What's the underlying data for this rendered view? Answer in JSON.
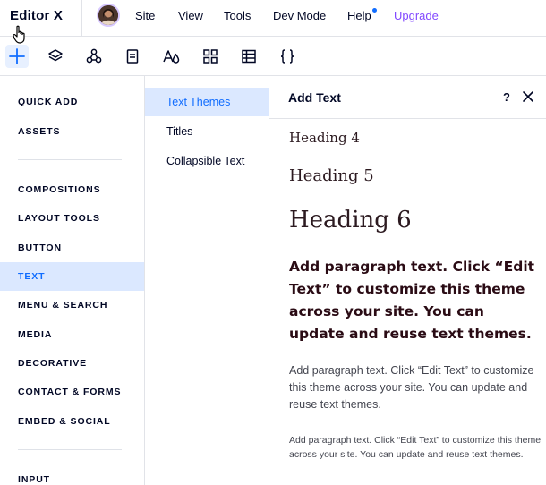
{
  "topbar": {
    "logo": "Editor X",
    "menu": [
      "Site",
      "View",
      "Tools",
      "Dev Mode",
      "Help",
      "Upgrade"
    ]
  },
  "toolbar": {
    "tools": [
      "add-icon",
      "layers-icon",
      "components-icon",
      "pages-icon",
      "text-styles-icon",
      "apps-icon",
      "table-icon",
      "code-braces-icon"
    ],
    "active_tool": "add-icon"
  },
  "categories": {
    "items": [
      "QUICK ADD",
      "ASSETS",
      "COMPOSITIONS",
      "LAYOUT TOOLS",
      "BUTTON",
      "TEXT",
      "MENU & SEARCH",
      "MEDIA",
      "DECORATIVE",
      "CONTACT & FORMS",
      "EMBED & SOCIAL",
      "INPUT"
    ],
    "active": "TEXT"
  },
  "sublist": {
    "items": [
      "Text Themes",
      "Titles",
      "Collapsible Text"
    ],
    "active": "Text Themes"
  },
  "panel": {
    "title": "Add Text",
    "help": "?",
    "heading4": "Heading 4",
    "heading5": "Heading 5",
    "heading6": "Heading 6",
    "paragraph_bold": "Add paragraph text. Click “Edit Text” to customize this theme across your site. You can update and reuse text themes.",
    "paragraph_regular": "Add paragraph text. Click “Edit Text” to customize this theme across your site. You can update and reuse text themes.",
    "paragraph_small": "Add paragraph text. Click “Edit Text” to customize this theme across your site. You can update and reuse text themes."
  },
  "colors": {
    "accent": "#116dff",
    "upgrade": "#8349ff",
    "active_bg": "#dbe8ff",
    "text": "#000624"
  }
}
